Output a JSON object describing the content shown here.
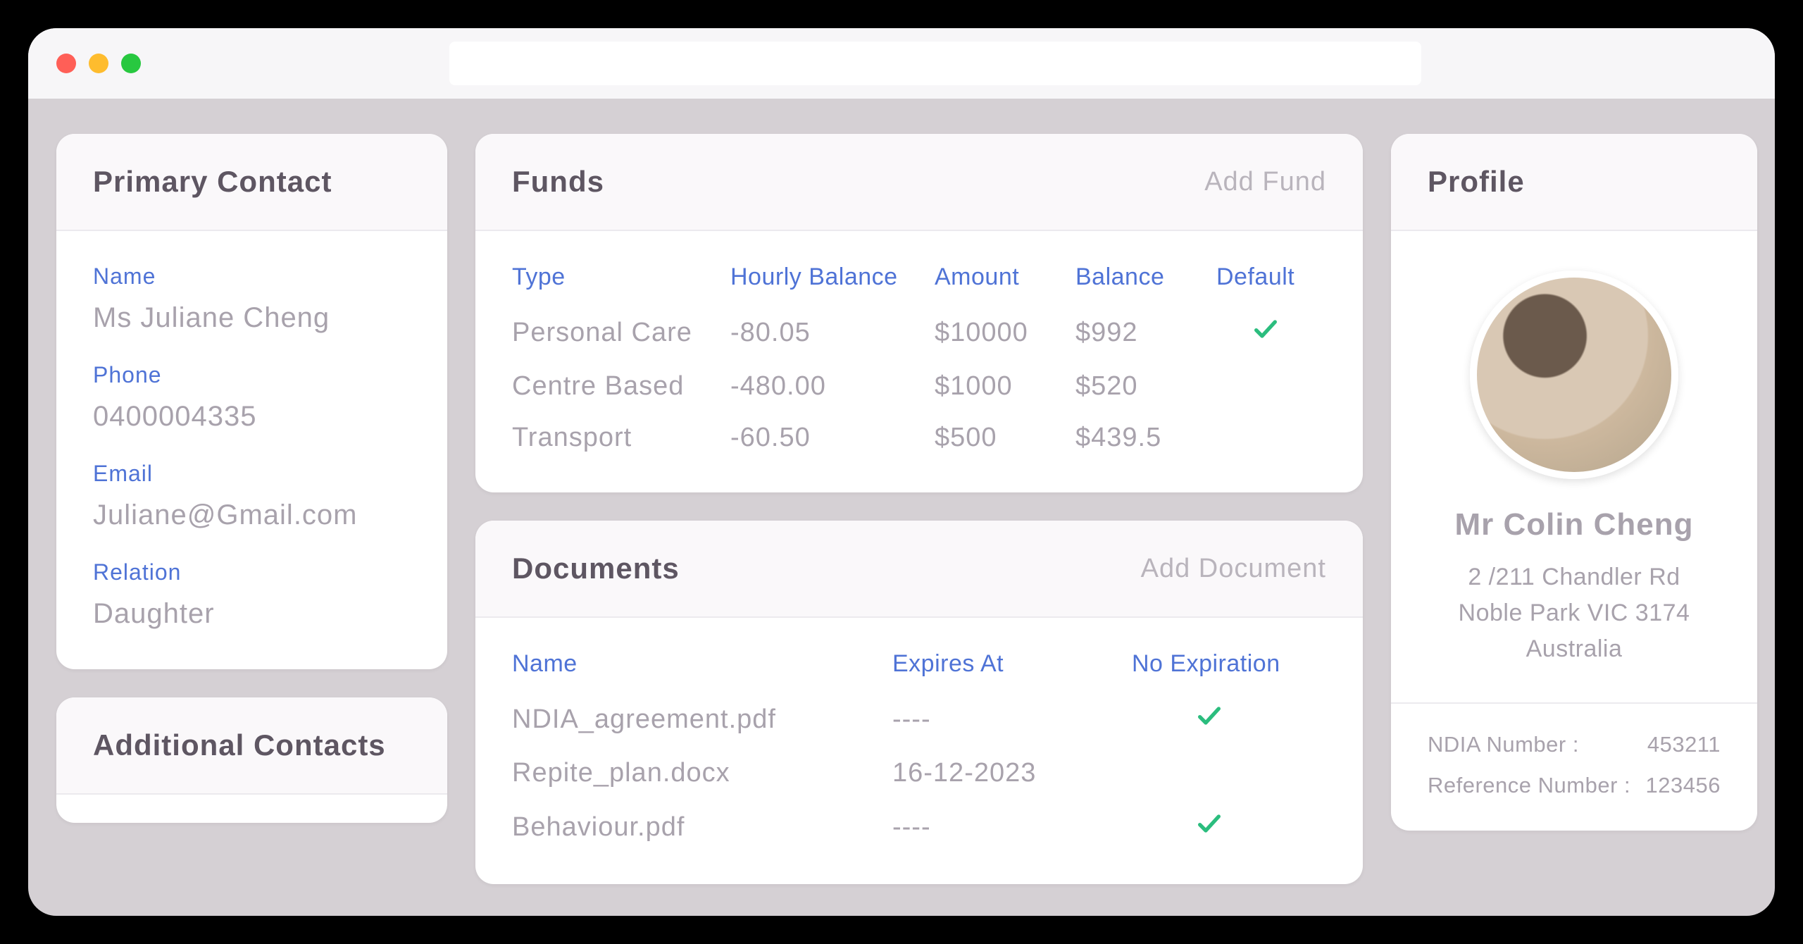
{
  "primary_contact": {
    "title": "Primary Contact",
    "labels": {
      "name": "Name",
      "phone": "Phone",
      "email": "Email",
      "relation": "Relation"
    },
    "name": "Ms Juliane Cheng",
    "phone": "0400004335",
    "email": "Juliane@Gmail.com",
    "relation": "Daughter"
  },
  "additional_contacts": {
    "title": "Additional Contacts"
  },
  "funds": {
    "title": "Funds",
    "add_label": "Add Fund",
    "headers": {
      "type": "Type",
      "hourly": "Hourly Balance",
      "amount": "Amount",
      "balance": "Balance",
      "default": "Default"
    },
    "rows": [
      {
        "type": "Personal Care",
        "hourly": "-80.05",
        "amount": "$10000",
        "balance": "$992",
        "default": true
      },
      {
        "type": "Centre Based",
        "hourly": "-480.00",
        "amount": "$1000",
        "balance": "$520",
        "default": false
      },
      {
        "type": "Transport",
        "hourly": "-60.50",
        "amount": "$500",
        "balance": "$439.5",
        "default": false
      }
    ]
  },
  "documents": {
    "title": "Documents",
    "add_label": "Add Document",
    "headers": {
      "name": "Name",
      "expires": "Expires At",
      "noexp": "No Expiration"
    },
    "rows": [
      {
        "name": "NDIA_agreement.pdf",
        "expires": "----",
        "noexp": true
      },
      {
        "name": "Repite_plan.docx",
        "expires": "16-12-2023",
        "noexp": false
      },
      {
        "name": "Behaviour.pdf",
        "expires": "----",
        "noexp": true
      }
    ]
  },
  "profile": {
    "title": "Profile",
    "name": "Mr Colin Cheng",
    "address_line1": "2 /211 Chandler Rd",
    "address_line2": "Noble Park VIC 3174",
    "address_line3": "Australia",
    "ndia_label": "NDIA Number :",
    "ndia_value": "453211",
    "ref_label": "Reference Number :",
    "ref_value": "123456"
  }
}
